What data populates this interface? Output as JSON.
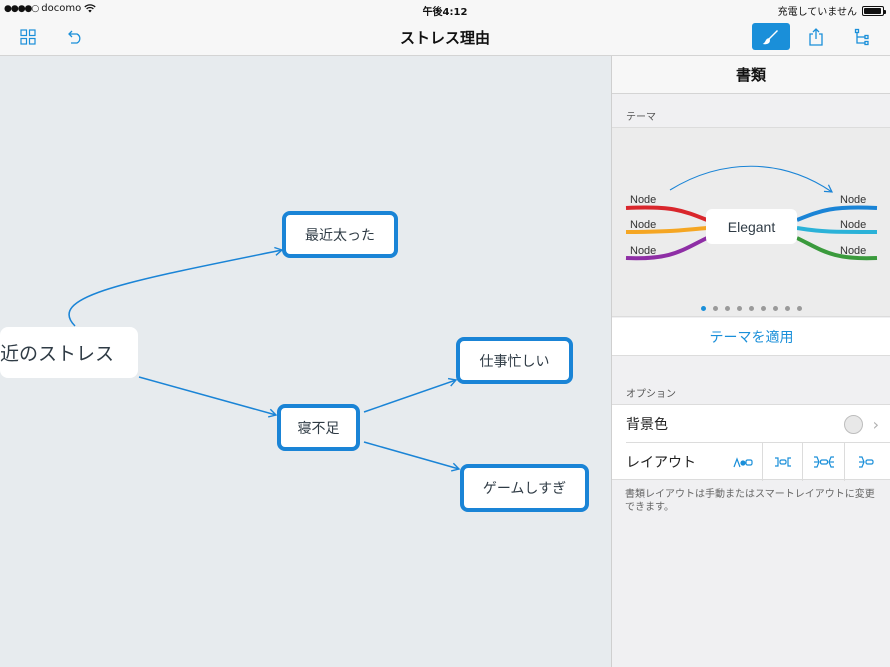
{
  "status_bar": {
    "carrier": "docomo",
    "time": "午後4:12",
    "charging": "充電していません"
  },
  "nav": {
    "title": "ストレス理由"
  },
  "mindmap": {
    "root": "近のストレス",
    "nodes": [
      "最近太った",
      "寝不足",
      "仕事忙しい",
      "ゲームしすぎ"
    ]
  },
  "panel": {
    "title": "書類",
    "theme_label": "テーマ",
    "theme_preview": {
      "center": "Elegant",
      "node_label": "Node",
      "branch_colors_left": [
        "#d9262c",
        "#f5a623",
        "#8e2ea5"
      ],
      "branch_colors_right": [
        "#1a84d6",
        "#2bb2d8",
        "#3a9a3c"
      ]
    },
    "page_count": 9,
    "active_page": 0,
    "apply_theme": "テーマを適用",
    "options_label": "オプション",
    "background_color": "背景色",
    "layout": "レイアウト",
    "help": "書類レイアウトは手動またはスマートレイアウトに変更できます。"
  },
  "colors": {
    "accent": "#1a8fd9",
    "node_border": "#1a84d6",
    "canvas_bg": "#e7ebee"
  }
}
